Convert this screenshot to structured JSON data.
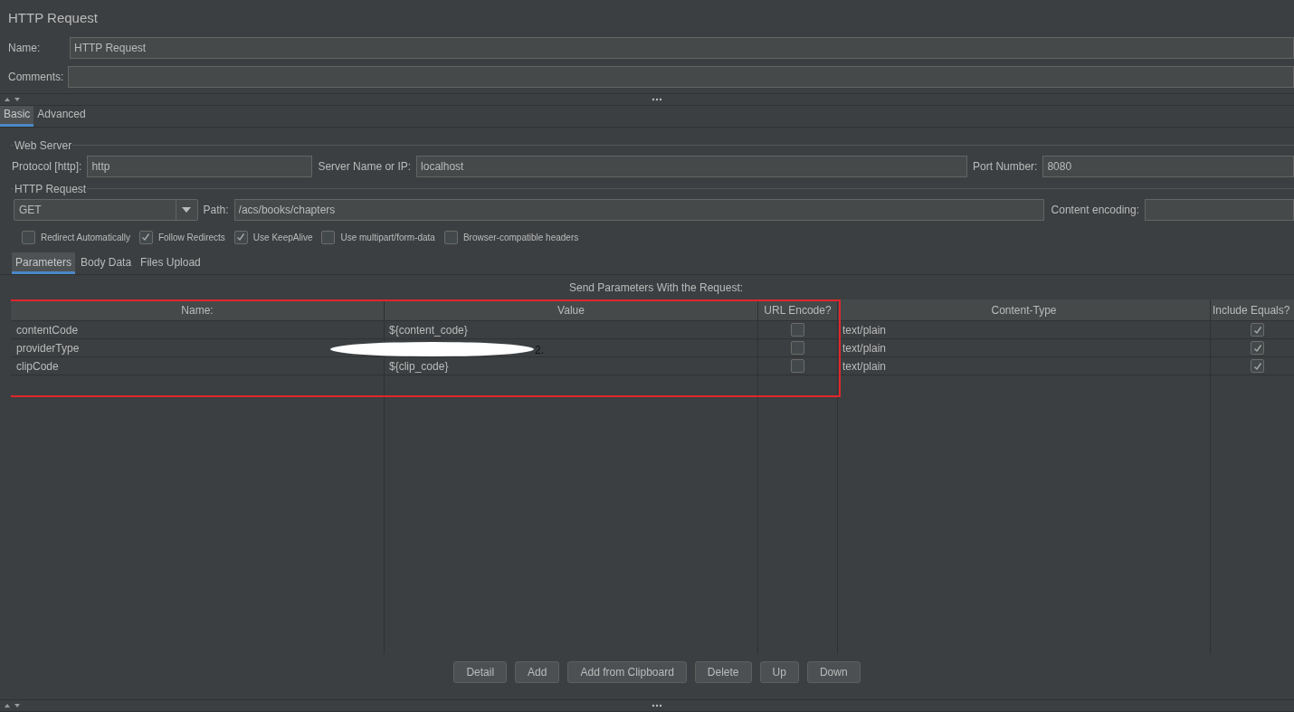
{
  "title": "HTTP Request",
  "name_field": {
    "label": "Name:",
    "value": "HTTP Request"
  },
  "comments_field": {
    "label": "Comments:"
  },
  "tabs": [
    {
      "label": "Basic",
      "selected": true
    },
    {
      "label": "Advanced",
      "selected": false
    }
  ],
  "web_server": {
    "legend": "Web Server",
    "fields": [
      {
        "label": "Protocol [http]:",
        "value": "http"
      },
      {
        "label": "Server Name or IP:",
        "value": "localhost"
      },
      {
        "label": "Port Number:",
        "value": "8080"
      }
    ]
  },
  "http_request": {
    "legend": "HTTP Request",
    "method": "GET",
    "path_label": "Path:",
    "path": "/acs/books/chapters",
    "encoding_label": "Content encoding:",
    "options": [
      {
        "label": "Redirect Automatically",
        "checked": false
      },
      {
        "label": "Follow Redirects",
        "checked": true
      },
      {
        "label": "Use KeepAlive",
        "checked": true
      },
      {
        "label": "Use multipart/form-data",
        "checked": false
      },
      {
        "label": "Browser-compatible headers",
        "checked": false
      }
    ]
  },
  "sub_tabs": [
    {
      "label": "Parameters",
      "selected": true
    },
    {
      "label": "Body Data",
      "selected": false
    },
    {
      "label": "Files Upload",
      "selected": false
    }
  ],
  "table": {
    "caption": "Send Parameters With the Request:",
    "columns": [
      "Name:",
      "Value",
      "URL Encode?",
      "Content-Type",
      "Include Equals?"
    ],
    "rows": [
      {
        "name": "contentCode",
        "value": "${content_code}",
        "redacted": false,
        "url_encode": false,
        "content_type": "text/plain",
        "include_equals": true
      },
      {
        "name": "providerType",
        "value": "2.",
        "redacted": true,
        "url_encode": false,
        "content_type": "text/plain",
        "include_equals": true
      },
      {
        "name": "clipCode",
        "value": "${clip_code}",
        "redacted": false,
        "url_encode": false,
        "content_type": "text/plain",
        "include_equals": true
      }
    ]
  },
  "buttons": [
    "Detail",
    "Add",
    "Add from Clipboard",
    "Delete",
    "Up",
    "Down"
  ]
}
